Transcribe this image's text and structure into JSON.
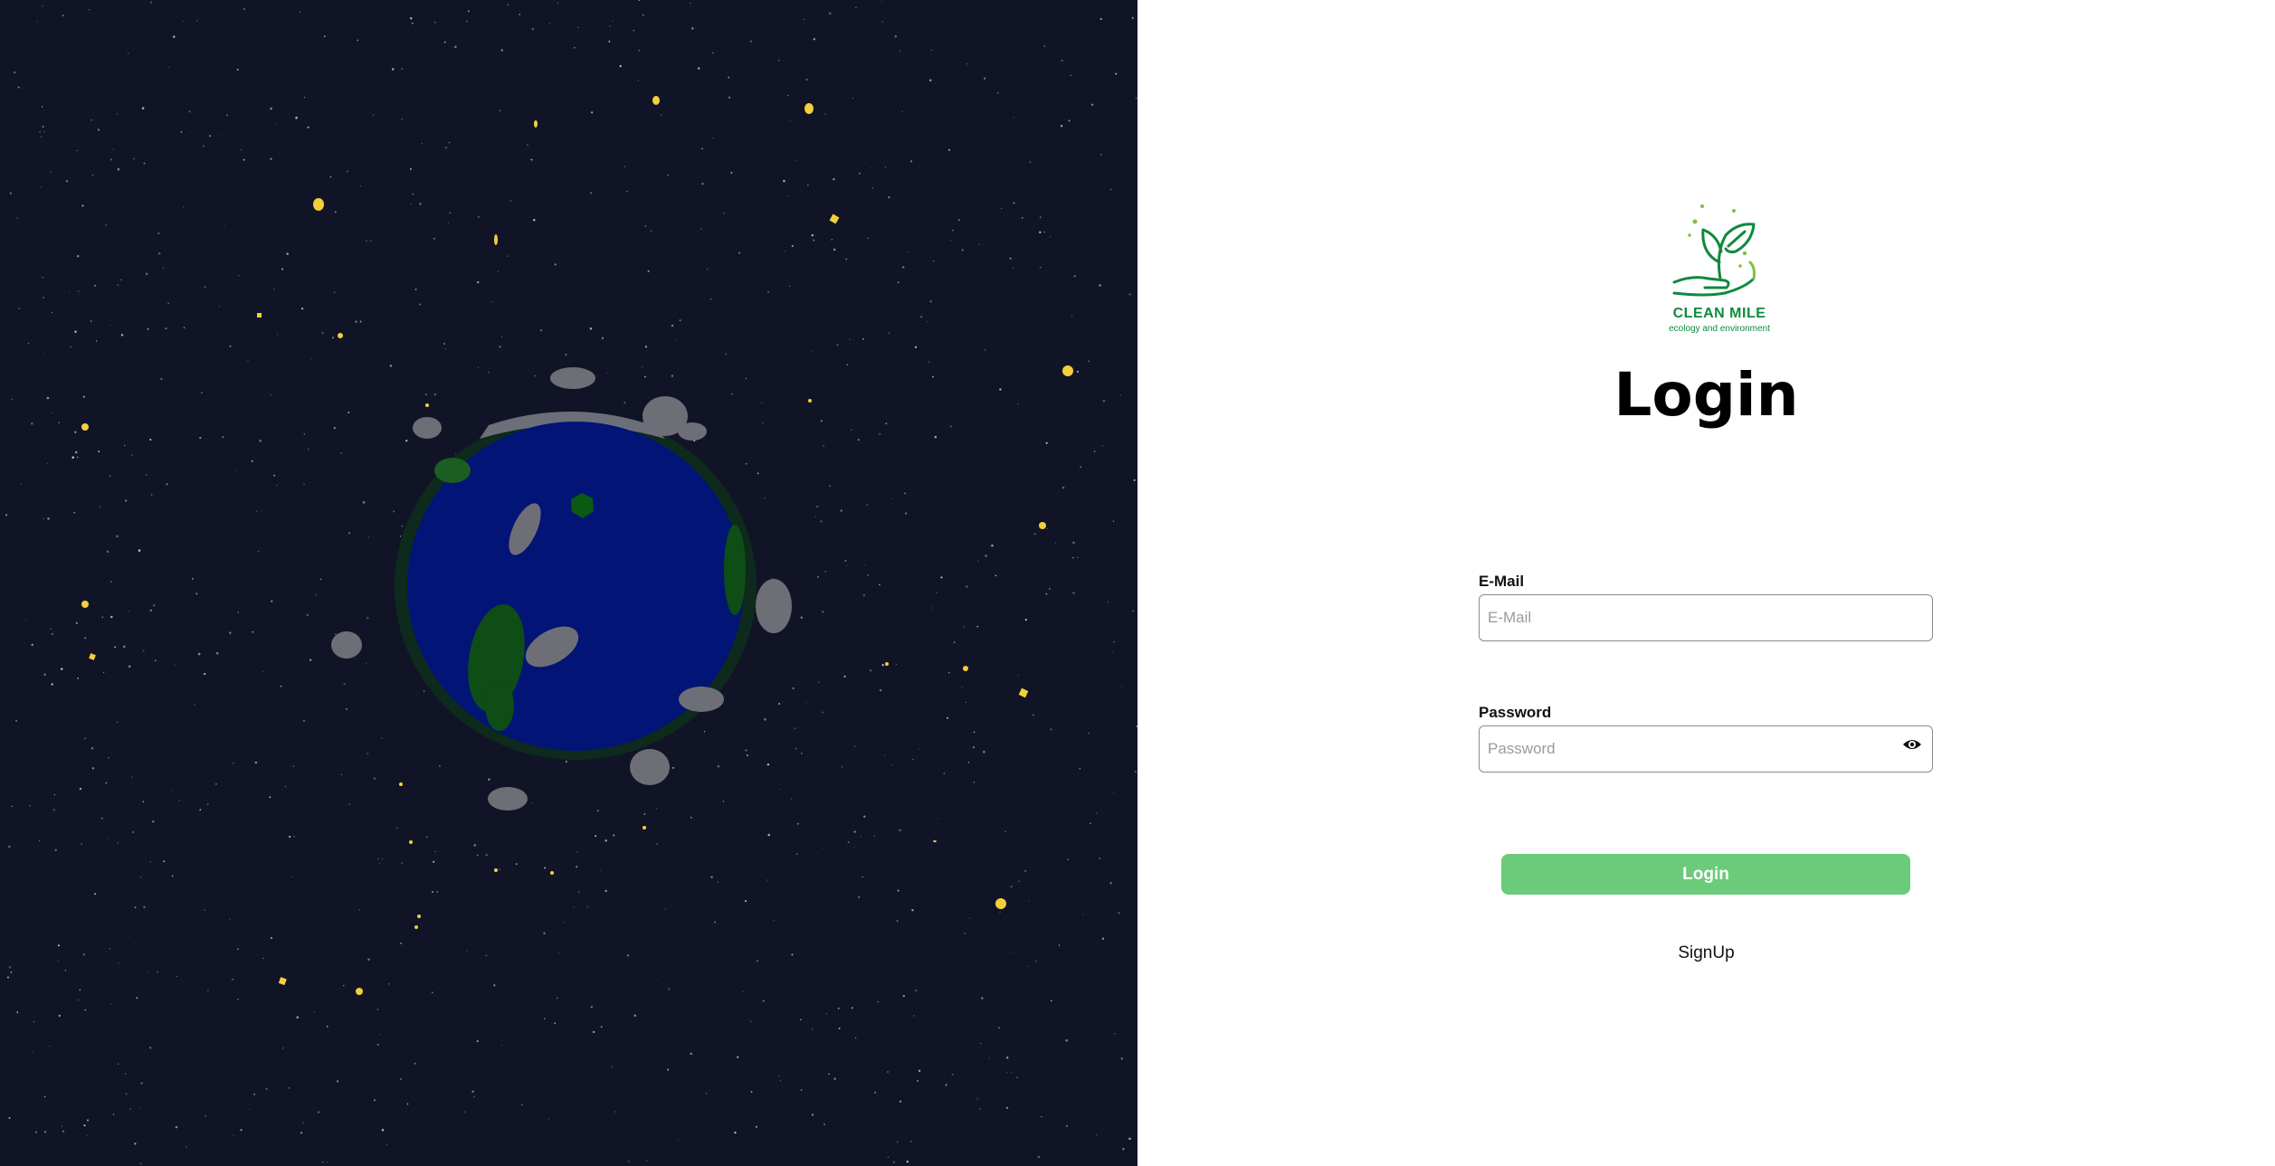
{
  "brand": {
    "name": "CLEAN MILE",
    "tagline": "ecology and environment",
    "color": "#0e8a3c"
  },
  "page": {
    "title": "Login",
    "left_background": "#111427",
    "planet_color": "#021476"
  },
  "form": {
    "email": {
      "label": "E-Mail",
      "placeholder": "E-Mail",
      "value": ""
    },
    "password": {
      "label": "Password",
      "placeholder": "Password",
      "value": "",
      "toggle_icon": "eye-icon"
    },
    "submit_label": "Login",
    "submit_color": "#6ccb7a",
    "signup_label": "SignUp"
  }
}
